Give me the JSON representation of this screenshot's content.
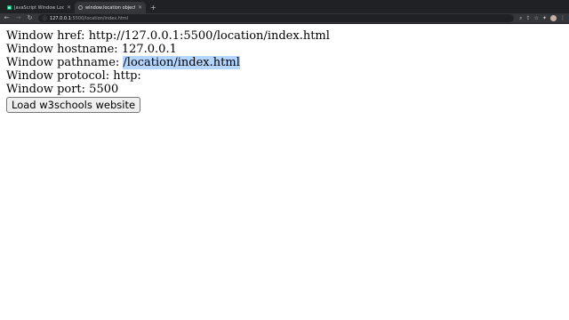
{
  "tabs": [
    {
      "title": "JavaScript Window Location",
      "favicon": "w3schools-icon",
      "active": false
    },
    {
      "title": "window.location object",
      "favicon": "globe-icon",
      "active": true
    }
  ],
  "toolbar": {
    "url_host": "127.0.0.1",
    "url_path": ":5500/location/index.html"
  },
  "page": {
    "href_label": "Window href: ",
    "href_value": "http://127.0.0.1:5500/location/index.html",
    "hostname_label": "Window hostname: ",
    "hostname_value": "127.0.0.1",
    "pathname_label": "Window pathname: ",
    "pathname_value": "/location/index.html",
    "protocol_label": "Window protocol: ",
    "protocol_value": "http:",
    "port_label": "Window port: ",
    "port_value": "5500",
    "button_label": "Load w3schools website"
  },
  "colors": {
    "selection": "#b4d5fe",
    "tabstrip": "#202124",
    "toolbar": "#35363a"
  }
}
